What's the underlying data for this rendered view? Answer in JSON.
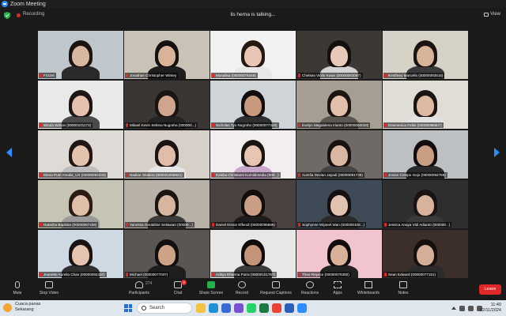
{
  "window": {
    "title": "Zoom Meeting"
  },
  "meeting": {
    "recording_label": "Recording",
    "talking_indicator": "lis herna is talking...",
    "view_label": "View"
  },
  "participants": [
    {
      "name": "Frizzel",
      "skin": "#d8b7a0",
      "hair": "#1b1410",
      "bg": "#bfc6cc",
      "shirt": "#2a2a2a",
      "muted": true
    },
    {
      "name": "Jonathan Christopher Wintey",
      "skin": "#d9b29a",
      "hair": "#151010",
      "bg": "#c9c2b6",
      "shirt": "#1e1e1e",
      "muted": true
    },
    {
      "name": "Monalisa (00000076448)",
      "skin": "#e7c6b5",
      "hair": "#241812",
      "bg": "#f1f1f1",
      "shirt": "#e8e8e8",
      "muted": true
    },
    {
      "name": "Chelsea Violin Kwan (00000093067)",
      "skin": "#e6c9b8",
      "hair": "#140e0c",
      "bg": "#3c3833",
      "shirt": "#d3d3d3",
      "muted": true
    },
    {
      "name": "Kenthrey Marcello (00000093515)",
      "skin": "#d7b39a",
      "hair": "#1a1311",
      "bg": "#d7d2c7",
      "shirt": "#3a3a3a",
      "muted": true
    },
    {
      "name": "Windo Wilson (00000101172)",
      "skin": "#e4c2ad",
      "hair": "#1e1614",
      "bg": "#e9e9e9",
      "shirt": "#4a4a4a",
      "muted": true
    },
    {
      "name": "Mikael Kevin Sebina Nugraha (000000...)",
      "skin": "#cfa68d",
      "hair": "#1a1412",
      "bg": "#3a3634",
      "shirt": "#232323",
      "muted": true
    },
    {
      "name": "Nicholas Tyo Nugroho (00000077420)",
      "skin": "#c89a7d",
      "hair": "#130e0d",
      "bg": "#cfd4d8",
      "shirt": "#2f2f2f",
      "muted": true
    },
    {
      "name": "Evelyn Magdalena Irianto (00000093028)",
      "skin": "#e2c0ab",
      "hair": "#1b1411",
      "bg": "#a79e93",
      "shirt": "#5b5651",
      "muted": true
    },
    {
      "name": "Desmenica Felim (00000096507)",
      "skin": "#dcb9a3",
      "hair": "#1b1311",
      "bg": "#e0dcd6",
      "shirt": "#e2e2e2",
      "muted": true
    },
    {
      "name": "Elena Putri Amalia_UX (00000094333)",
      "skin": "#e3c2ae",
      "hair": "#221614",
      "bg": "#dedad5",
      "shirt": "#bdbdbd",
      "muted": true
    },
    {
      "name": "Nadine Shabira (000001006621)",
      "skin": "#e0bda8",
      "hair": "#1a1311",
      "bg": "#d6d0c8",
      "shirt": "#e6e6e6",
      "muted": true
    },
    {
      "name": "Keisha Christianti Kurnidimedia (000...)",
      "skin": "#e6c5b2",
      "hair": "#1b1410",
      "bg": "#f2eef0",
      "shirt": "#c8a7c8",
      "muted": true
    },
    {
      "name": "Aurelia Devian Jayadi (00000091739)",
      "skin": "#d9b7a2",
      "hair": "#1a1211",
      "bg": "#6f6a66",
      "shirt": "#444",
      "muted": true
    },
    {
      "name": "Jovian Crespo Gejo (00000092769)",
      "skin": "#c99f84",
      "hair": "#120d0c",
      "bg": "#bcc0c3",
      "shirt": "#2b2b2b",
      "muted": true
    },
    {
      "name": "Natasha Baptista (00000067436)",
      "skin": "#dfbfa8",
      "hair": "#2a1b14",
      "bg": "#c6c5b4",
      "shirt": "#9a9a9a",
      "muted": true
    },
    {
      "name": "Vanessa Geraldine Setiawan (00000...)",
      "skin": "#d7b6a0",
      "hair": "#1b1411",
      "bg": "#b8b1a8",
      "shirt": "#3b3b3b",
      "muted": true
    },
    {
      "name": "Daniel Eiston Effendi (00000095866)",
      "skin": "#c89e85",
      "hair": "#120d0b",
      "bg": "#4a4240",
      "shirt": "#1c1c1c",
      "muted": true
    },
    {
      "name": "Sophynne Wijanet Wan (000000108...)",
      "skin": "#e1c2b0",
      "hair": "#151010",
      "bg": "#3f4a57",
      "shirt": "#2a2a2a",
      "muted": true
    },
    {
      "name": "Jessica Anaya Vidi Adianto (000000...)",
      "skin": "#d8b39b",
      "hair": "#1b1311",
      "bg": "#2e2e30",
      "shirt": "#3a3a3a",
      "muted": true
    },
    {
      "name": "Jeanette Aurelia Chan (00000092420)",
      "skin": "#e4c4b0",
      "hair": "#1a1311",
      "bg": "#cfd9e4",
      "shirt": "#2f2f2f",
      "muted": true
    },
    {
      "name": "Michael (00000077037)",
      "skin": "#cda387",
      "hair": "#120e0d",
      "bg": "#5a5654",
      "shirt": "#1e1e1e",
      "muted": true
    },
    {
      "name": "Aditya Dharma Putra (00000101767)",
      "skin": "#c39478",
      "hair": "#110c0b",
      "bg": "#e7e7e7",
      "shirt": "#3a3a3a",
      "muted": true
    },
    {
      "name": "Theo Reyoce (00000076300)",
      "skin": "#d8b19a",
      "hair": "#120d0c",
      "bg": "#f2c4cf",
      "shirt": "#222",
      "muted": true
    },
    {
      "name": "Sean Edward (00000077151)",
      "skin": "#d4ae96",
      "hair": "#150f0e",
      "bg": "#3c2f2a",
      "shirt": "#2b2b2b",
      "muted": true
    }
  ],
  "toolbar": {
    "mute": "Mute",
    "stop_video": "Stop Video",
    "participants": "Participants",
    "participants_count": "274",
    "chat": "Chat",
    "chat_badge": "3",
    "share_screen": "Share Screen",
    "record": "Record",
    "captions": "Request Captions",
    "reactions": "Reactions",
    "apps": "Apps",
    "whiteboards": "Whiteboards",
    "notes": "Notes",
    "leave": "Leave"
  },
  "taskbar": {
    "weather_title": "Cuaca panas",
    "weather_sub": "Sekarang",
    "search_placeholder": "Search",
    "time": "11:40",
    "date": "02/11/2024",
    "apps": [
      {
        "name": "file-explorer",
        "color": "#f5c242"
      },
      {
        "name": "edge",
        "color": "#1f8fd6"
      },
      {
        "name": "store",
        "color": "#3b6ad6"
      },
      {
        "name": "app",
        "color": "#7a4fd1"
      },
      {
        "name": "whatsapp",
        "color": "#25d366"
      },
      {
        "name": "excel",
        "color": "#1d7a45"
      },
      {
        "name": "chrome",
        "color": "#e84335"
      },
      {
        "name": "word",
        "color": "#2b5fb8"
      },
      {
        "name": "zoom",
        "color": "#2d8cff"
      }
    ]
  }
}
